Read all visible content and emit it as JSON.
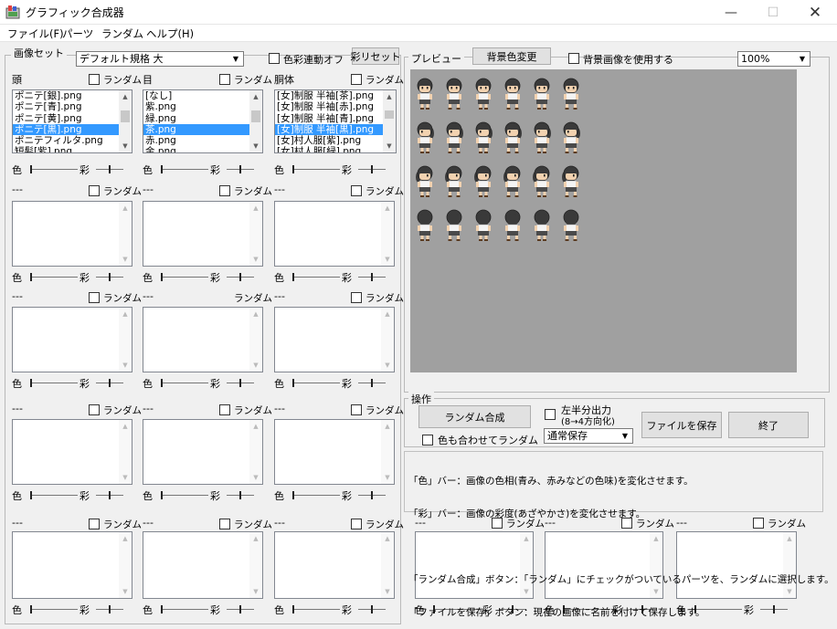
{
  "window": {
    "title": "グラフィック合成器"
  },
  "menu": [
    "ファイル(F)",
    "パーツ",
    "ランダム",
    "ヘルプ(H)"
  ],
  "imageset": {
    "group_title": "画像セット",
    "format_value": "デフォルト規格 大",
    "color_link_label": "色彩連動オフ",
    "reset_button": "彩リセット"
  },
  "common": {
    "random": "ランダム",
    "hue": "色",
    "sat": "彩"
  },
  "parts": [
    {
      "title": "頭",
      "items": [
        "ポニテ[銀].png",
        "ポニテ[青].png",
        "ポニテ[黄].png",
        "ポニテ[黒].png",
        "ポニテフィルタ.png",
        "短髪[紫].png"
      ],
      "selected": 3,
      "thumb_top": 0.2,
      "thumb_h": 0.3
    },
    {
      "title": "目",
      "items": [
        "[なし]",
        "紫.png",
        "緑.png",
        "茶.png",
        "赤.png",
        "金.png"
      ],
      "selected": 3,
      "thumb_top": 0.2,
      "thumb_h": 0.3
    },
    {
      "title": "胴体",
      "items": [
        "[女]制服 半袖[茶]",
        "[女]制服 半袖[赤]",
        "[女]制服 半袖[青]",
        "[女]制服 半袖[黒]",
        "[女]村人服[紫]",
        "[女]村人服[緑]"
      ],
      "suffixes": [
        ".png",
        ".png",
        ".png",
        ".png",
        ".png",
        ".png"
      ],
      "selected": 3,
      "thumb_top": 0.2,
      "thumb_h": 0.2
    }
  ],
  "empty_title": "---",
  "preview": {
    "group_title": "プレビュー",
    "bg_color_button": "背景色変更",
    "bg_image_label": "背景画像を使用する",
    "zoom": "100%",
    "sprite_colors": {
      "hair": "#3a3a3a",
      "skin": "#f2d2b0",
      "shirt": "#f4f4f4",
      "skirt": "#4a4a4a",
      "outline": "#222222"
    }
  },
  "ops": {
    "group_title": "操作",
    "random_button": "ランダム合成",
    "color_random_label": "色も合わせてランダム",
    "half_output_label1": "左半分出力",
    "half_output_label2": "(8→4方向化)",
    "save_mode": "通常保存",
    "save_button": "ファイルを保存",
    "exit_button": "終了"
  },
  "help": {
    "lines": [
      "「色」バー：画像の色相(青み、赤みなどの色味)を変化させます。",
      "「彩」バー：画像の彩度(あざやかさ)を変化させます。",
      "",
      "「ランダム合成」ボタン：「ランダム」にチェックがついているパーツを、ランダムに選択します。",
      "「ファイルを保存」ボタン：現在の画像に名前を付けて保存します。"
    ]
  }
}
